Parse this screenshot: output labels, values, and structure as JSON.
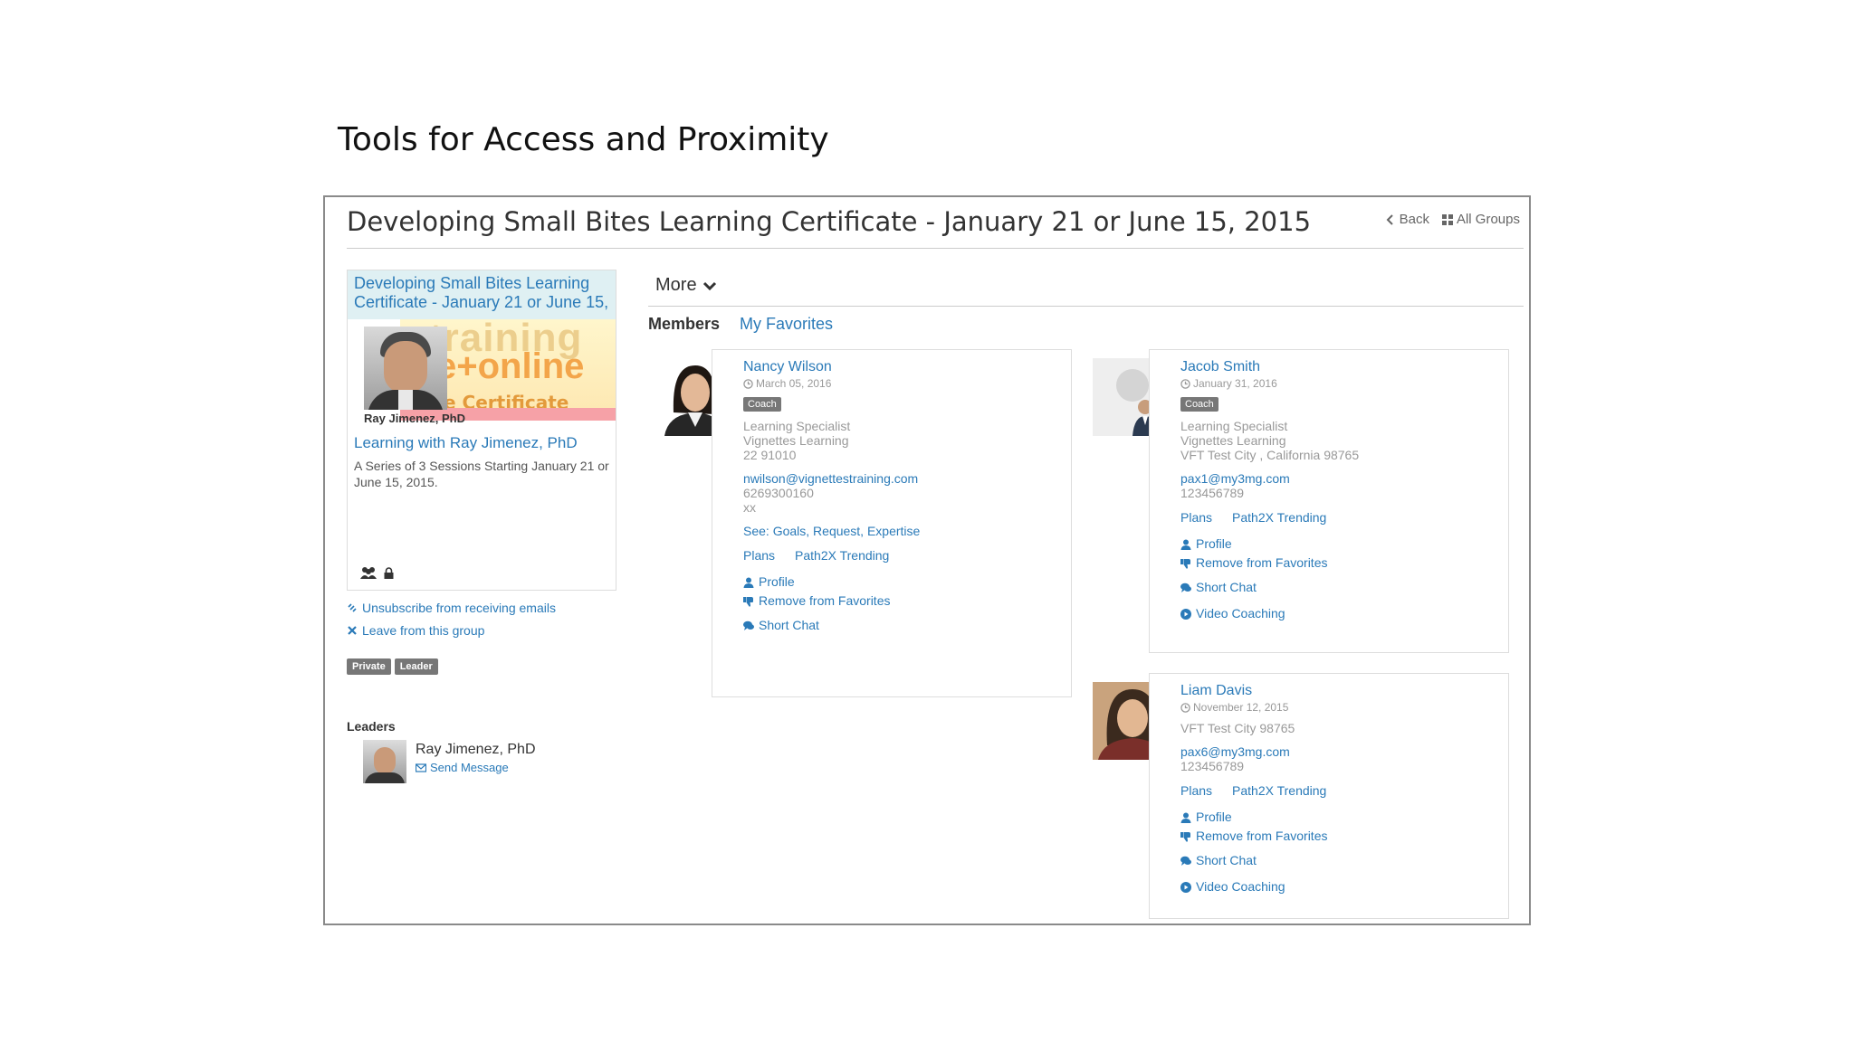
{
  "slide": {
    "title": "Tools for Access and Proximity"
  },
  "page": {
    "title": "Developing Small Bites Learning Certificate - January 21 or June 15, 2015",
    "back_label": "Back",
    "all_groups_label": "All Groups"
  },
  "group": {
    "banner": "Developing Small Bites Learning Certificate - January 21 or June 15,",
    "image_text": {
      "line1": "training",
      "line2": "e+online",
      "line3": "e Certificate Programs"
    },
    "portrait_name": "Ray Jimenez, PhD",
    "course_link": "Learning with Ray Jimenez, PhD",
    "course_desc": "A Series of 3 Sessions Starting January 21 or June 15, 2015.",
    "unsubscribe": "Unsubscribe from receiving emails",
    "leave": "Leave from this group",
    "badges": [
      "Private",
      "Leader"
    ],
    "leaders_heading": "Leaders",
    "leader_name": "Ray Jimenez, PhD",
    "send_message": "Send Message"
  },
  "main": {
    "more_label": "More",
    "tabs": [
      {
        "label": "Members"
      },
      {
        "label": "My Favorites"
      }
    ]
  },
  "members": [
    {
      "name": "Nancy Wilson",
      "date": "March 05, 2016",
      "badge": "Coach",
      "info": [
        "Learning Specialist",
        "Vignettes Learning",
        "22 91010"
      ],
      "email": "nwilson@vignettestraining.com",
      "phone": [
        "6269300160",
        "xx"
      ],
      "see": "See: Goals, Request, Expertise",
      "plans": [
        "Plans",
        "Path2X Trending"
      ],
      "actions": [
        "Profile",
        "Remove from Favorites",
        "Short Chat"
      ]
    },
    {
      "name": "Jacob Smith",
      "date": "January 31, 2016",
      "badge": "Coach",
      "info": [
        "Learning Specialist",
        "Vignettes Learning",
        "VFT Test City , California 98765"
      ],
      "email": "pax1@my3mg.com",
      "phone": [
        "123456789"
      ],
      "plans": [
        "Plans",
        "Path2X Trending"
      ],
      "actions": [
        "Profile",
        "Remove from Favorites",
        "Short Chat",
        "Video Coaching"
      ]
    },
    {
      "name": "Liam Davis",
      "date": "November 12, 2015",
      "info": [
        "VFT Test City 98765"
      ],
      "email": "pax6@my3mg.com",
      "phone": [
        "123456789"
      ],
      "plans": [
        "Plans",
        "Path2X Trending"
      ],
      "actions": [
        "Profile",
        "Remove from Favorites",
        "Short Chat",
        "Video Coaching"
      ]
    }
  ],
  "colors": {
    "link": "#2a7ab8",
    "badge": "#777777",
    "banner": "#dff0f3"
  }
}
